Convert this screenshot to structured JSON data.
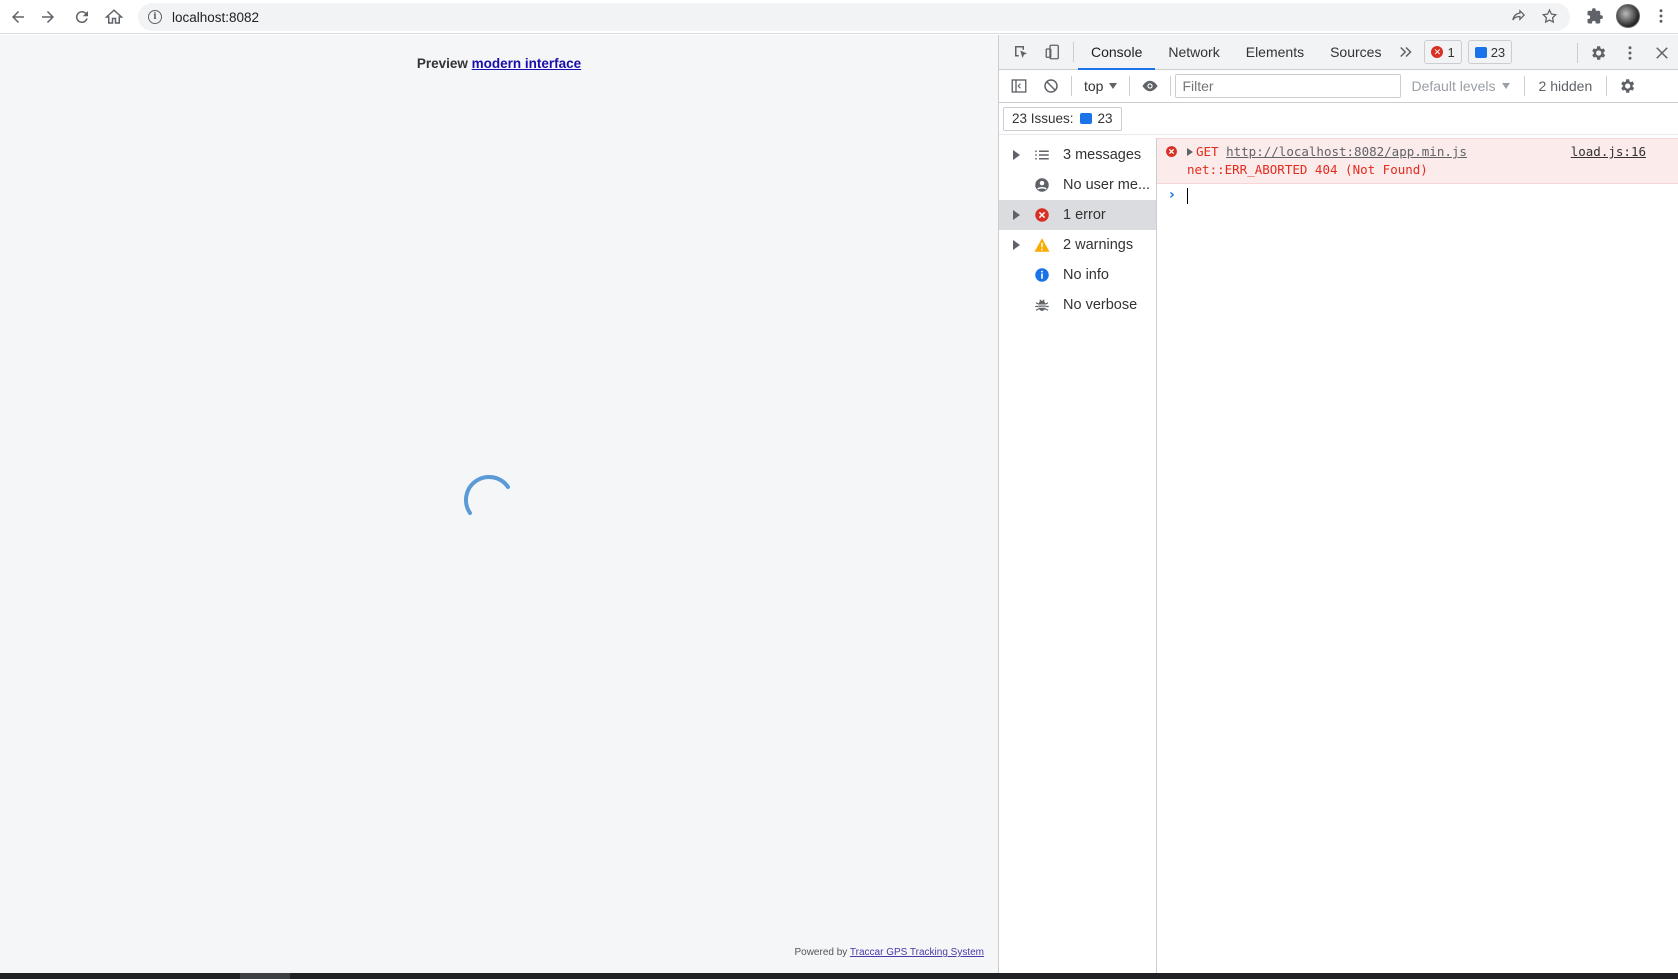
{
  "browser": {
    "url": "localhost:8082"
  },
  "page": {
    "preview_prefix": "Preview",
    "preview_link": "modern interface",
    "powered_prefix": "Powered by",
    "powered_link": "Traccar GPS Tracking System"
  },
  "devtools": {
    "tabs": [
      {
        "label": "Console",
        "active": true
      },
      {
        "label": "Network",
        "active": false
      },
      {
        "label": "Elements",
        "active": false
      },
      {
        "label": "Sources",
        "active": false
      }
    ],
    "error_count": "1",
    "issues_count": "23",
    "context": "top",
    "filter_placeholder": "Filter",
    "default_levels": "Default levels",
    "hidden": "2 hidden",
    "issues_label": "23 Issues:",
    "issues_badge": "23",
    "sidebar": [
      {
        "label": "3 messages",
        "icon": "list-icon",
        "expandable": true
      },
      {
        "label": "No user me...",
        "icon": "user-icon",
        "expandable": false
      },
      {
        "label": "1 error",
        "icon": "error-icon",
        "expandable": true,
        "selected": true
      },
      {
        "label": "2 warnings",
        "icon": "warning-icon",
        "expandable": true
      },
      {
        "label": "No info",
        "icon": "info-icon",
        "expandable": false
      },
      {
        "label": "No verbose",
        "icon": "bug-icon",
        "expandable": false
      }
    ],
    "console": {
      "error_method": "GET",
      "error_url": "http://localhost:8082/app.min.js",
      "error_detail": "net::ERR_ABORTED 404 (Not Found)",
      "error_source": "load.js:16"
    }
  },
  "colors": {
    "accent": "#1a73e8",
    "error": "#d93025",
    "warning": "#f9ab00",
    "spinner": "#5b9bd5"
  }
}
